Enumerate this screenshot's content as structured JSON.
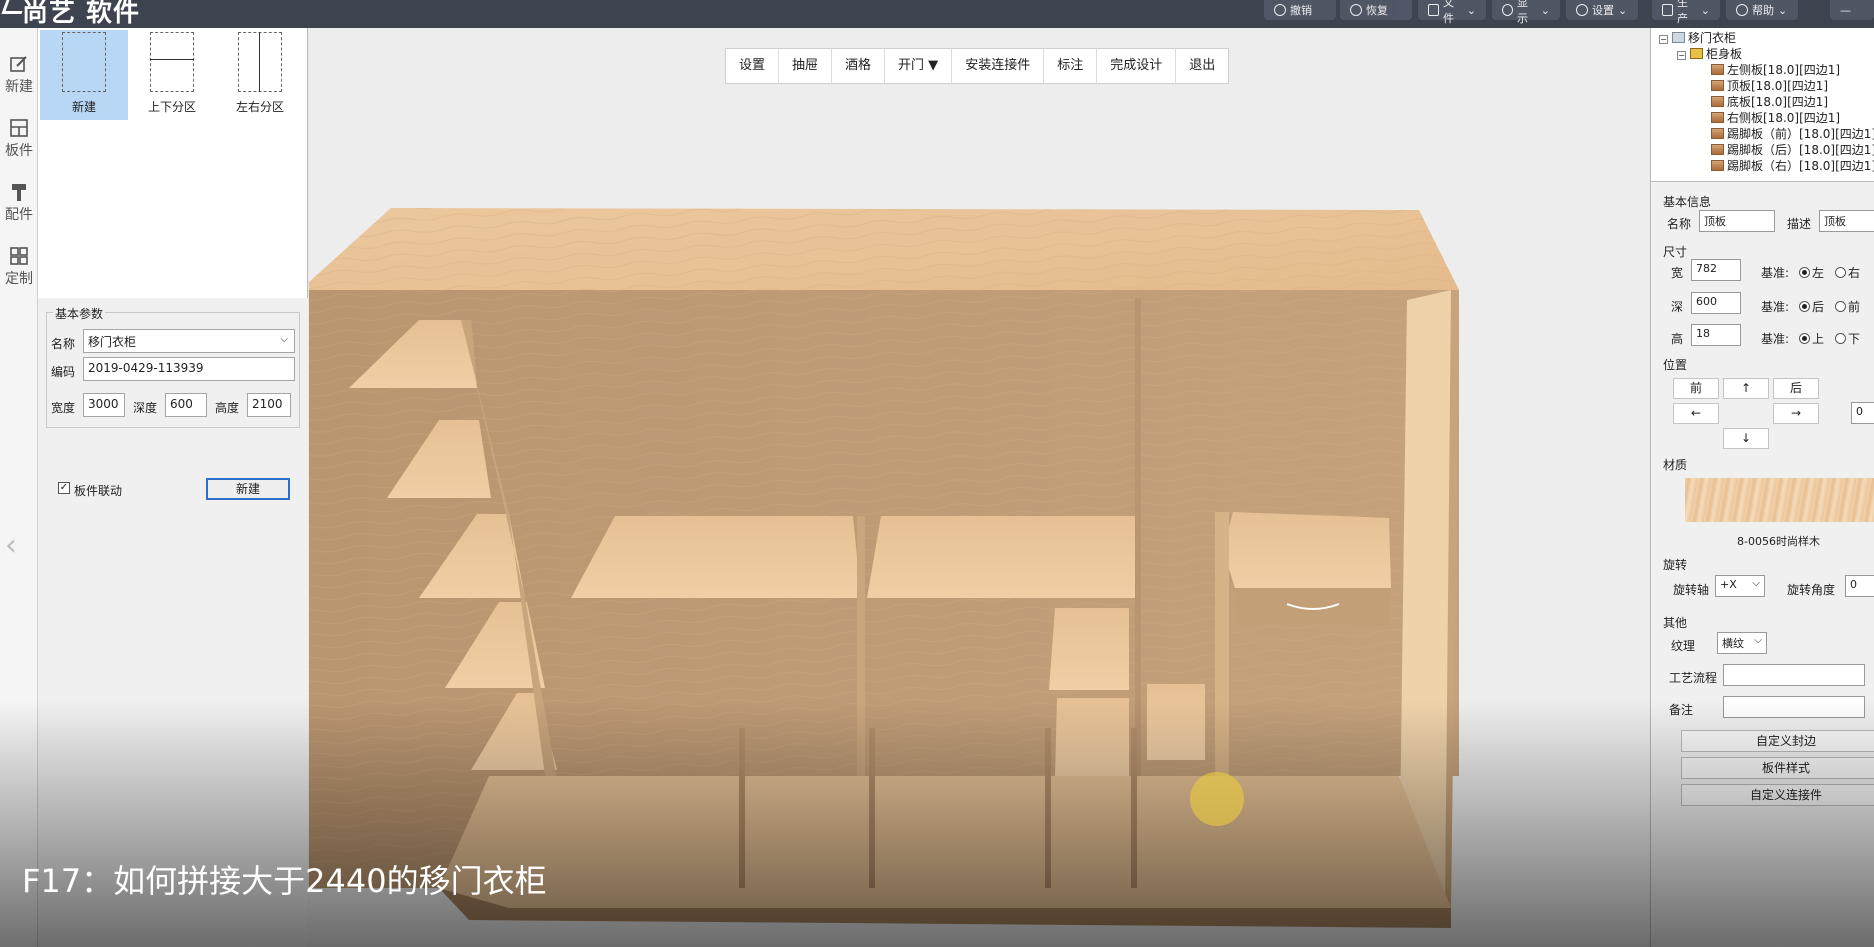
{
  "app": {
    "title": "尚艺 软件"
  },
  "top_menu": [
    {
      "label": "撤销",
      "icon": "undo-icon"
    },
    {
      "label": "恢复",
      "icon": "redo-icon"
    },
    {
      "label": "文件",
      "icon": "file-icon"
    },
    {
      "label": "显示",
      "icon": "eye-icon"
    },
    {
      "label": "设置",
      "icon": "gear-icon"
    },
    {
      "label": "生产",
      "icon": "production-icon"
    },
    {
      "label": "帮助",
      "icon": "help-icon"
    }
  ],
  "sidebar": {
    "items": [
      {
        "label": "新建",
        "icon": "edit-icon"
      },
      {
        "label": "板件",
        "icon": "grid-icon"
      },
      {
        "label": "配件",
        "icon": "hammer-icon"
      },
      {
        "label": "定制",
        "icon": "apps-icon"
      }
    ]
  },
  "tools": [
    {
      "label": "新建"
    },
    {
      "label": "上下分区"
    },
    {
      "label": "左右分区"
    }
  ],
  "params": {
    "legend": "基本参数",
    "name_label": "名称",
    "name_value": "移门衣柜",
    "code_label": "编码",
    "code_value": "2019-0429-113939",
    "width_label": "宽度",
    "width_value": "3000",
    "depth_label": "深度",
    "depth_value": "600",
    "height_label": "高度",
    "height_value": "2100",
    "linkage_label": "板件联动",
    "new_button": "新建"
  },
  "view_toolbar": [
    "设置",
    "抽屉",
    "酒格",
    "开门 ▼",
    "安装连接件",
    "标注",
    "完成设计",
    "退出"
  ],
  "caption": "F17：如何拼接大于2440的移门衣柜",
  "tree": {
    "root": "移门衣柜",
    "group": "柜身板",
    "items": [
      "左侧板[18.0][四边1]",
      "顶板[18.0][四边1]",
      "底板[18.0][四边1]",
      "右侧板[18.0][四边1]",
      "踢脚板（前）[18.0][四边1]",
      "踢脚板（后）[18.0][四边1]",
      "踢脚板（右）[18.0][四边1]"
    ]
  },
  "props": {
    "basic_title": "基本信息",
    "name_label": "名称",
    "name_value": "顶板",
    "desc_label": "描述",
    "desc_value": "顶板",
    "size_title": "尺寸",
    "w_label": "宽",
    "w_value": "782",
    "d_label": "深",
    "d_value": "600",
    "h_label": "高",
    "h_value": "18",
    "base_label": "基准:",
    "w_opt_a": "左",
    "w_opt_b": "右",
    "d_opt_a": "后",
    "d_opt_b": "前",
    "h_opt_a": "上",
    "h_opt_b": "下",
    "pos_title": "位置",
    "pos_front": "前",
    "pos_up": "↑",
    "pos_back": "后",
    "pos_left": "←",
    "pos_right": "→",
    "pos_down": "↓",
    "pos_value": "0",
    "material_title": "材质",
    "material_name": "8-0056时尚样木",
    "rotate_title": "旋转",
    "rotate_axis_label": "旋转轴",
    "rotate_axis_value": "+X",
    "rotate_angle_label": "旋转角度",
    "rotate_angle_value": "0",
    "other_title": "其他",
    "grain_label": "纹理",
    "grain_value": "横纹",
    "process_label": "工艺流程",
    "process_value": "",
    "note_label": "备注",
    "note_value": "",
    "btn_edge": "自定义封边",
    "btn_style": "板件样式",
    "btn_connector": "自定义连接件"
  },
  "colors": {
    "topbar": "#3d4450",
    "wood_light": "#e9c39a",
    "wood_dark": "#bd9a72",
    "accent": "#2a6fc8"
  }
}
